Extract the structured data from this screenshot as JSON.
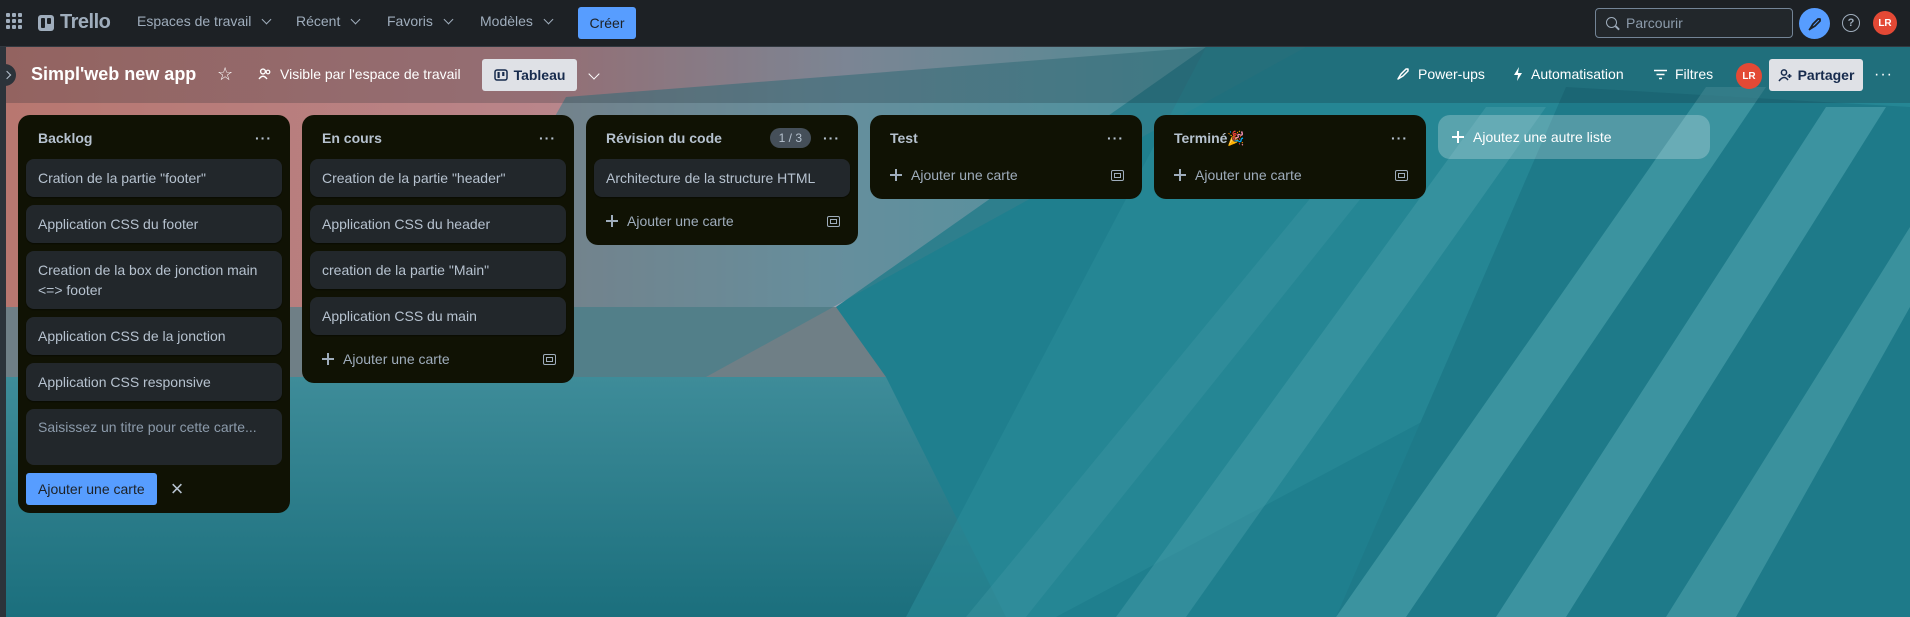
{
  "nav": {
    "logo": "Trello",
    "menus": [
      "Espaces de travail",
      "Récent",
      "Favoris",
      "Modèles"
    ],
    "create_label": "Créer",
    "search_placeholder": "Parcourir",
    "avatar_initials": "LR"
  },
  "board": {
    "title": "Simpl'web new app",
    "visibility_label": "Visible par l'espace de travail",
    "view_label": "Tableau",
    "actions": [
      "Power-ups",
      "Automatisation",
      "Filtres"
    ],
    "member_initials": "LR",
    "share_label": "Partager"
  },
  "lists": [
    {
      "title": "Backlog",
      "cards": [
        "Cration de la partie \"footer\"",
        "Application CSS du footer",
        "Creation de la box de jonction main <=> footer",
        "Application CSS de la jonction",
        "Application CSS responsive"
      ],
      "composer_placeholder": "Saisissez un titre pour cette carte...",
      "composer_button": "Ajouter une carte"
    },
    {
      "title": "En cours",
      "cards": [
        "Creation de la partie \"header\"",
        "Application CSS du header",
        "creation de la partie \"Main\"",
        "Application CSS du main"
      ],
      "add_label": "Ajouter une carte"
    },
    {
      "title": "Révision du code",
      "count": "1 / 3",
      "cards": [
        "Architecture de la structure HTML"
      ],
      "add_label": "Ajouter une carte"
    },
    {
      "title": "Test",
      "cards": [],
      "add_label": "Ajouter une carte"
    },
    {
      "title": "Terminé🎉",
      "cards": [],
      "add_label": "Ajouter une carte"
    }
  ],
  "add_list_label": "Ajoutez une autre liste",
  "icons": {
    "apps": "apps-grid-icon",
    "search": "search-icon",
    "whats_new": "rocket-icon",
    "help": "help-icon",
    "star": "star-icon",
    "visibility": "people-icon",
    "view": "board-icon",
    "power_ups": "rocket-icon",
    "automation": "lightning-icon",
    "filter": "filter-icon",
    "share": "add-user-icon",
    "more": "more-icon",
    "card_template": "card-template-icon",
    "close": "close-icon"
  },
  "colors": {
    "nav_bg": "#1d2125",
    "accent": "#579dff",
    "list_bg": "#101204",
    "card_bg": "#22272b",
    "avatar": "#e34935",
    "board_teal": "#1e7d8c"
  }
}
